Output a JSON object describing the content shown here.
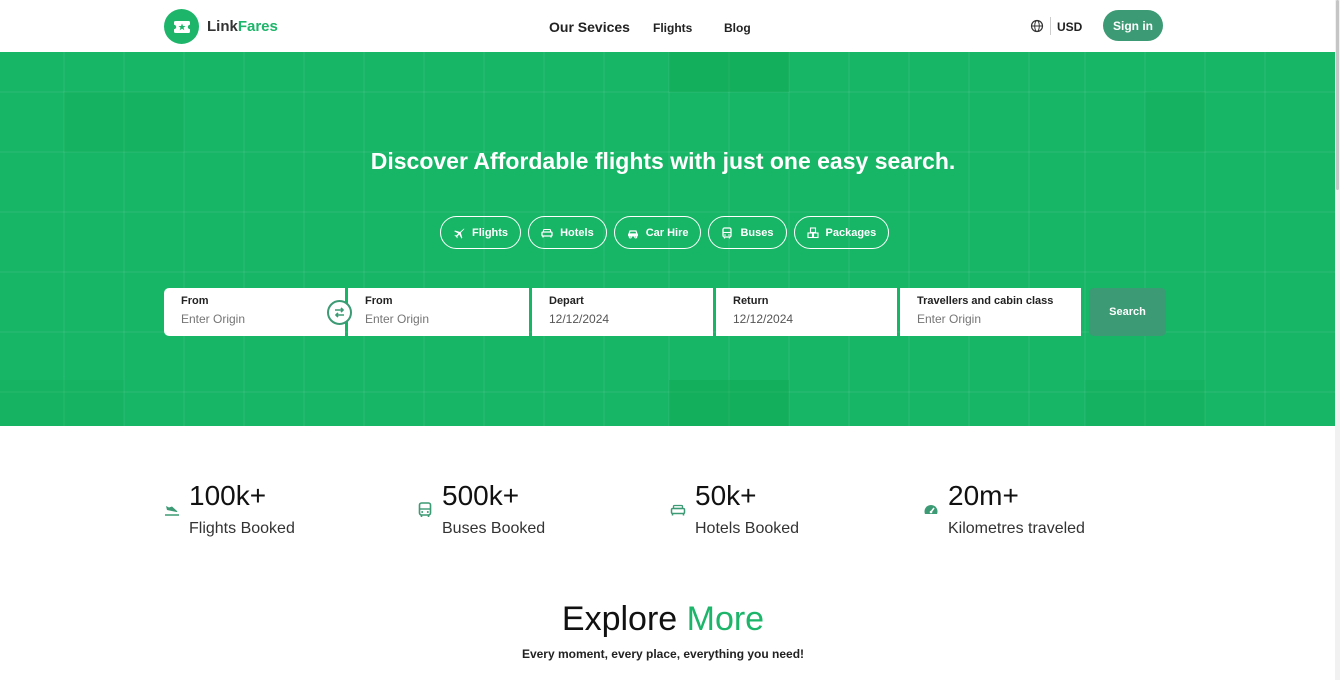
{
  "brand": {
    "name_part1": "Link",
    "name_part2": "Fares"
  },
  "nav": {
    "services": "Our Sevices",
    "flights": "Flights",
    "blog": "Blog"
  },
  "header": {
    "currency": "USD",
    "signin": "Sign in"
  },
  "hero": {
    "title": "Discover Affordable flights with just one easy search.",
    "tabs": [
      {
        "label": "Flights",
        "icon": "plane-icon"
      },
      {
        "label": "Hotels",
        "icon": "bed-icon"
      },
      {
        "label": "Car Hire",
        "icon": "car-icon"
      },
      {
        "label": "Buses",
        "icon": "bus-icon"
      },
      {
        "label": "Packages",
        "icon": "packages-icon"
      }
    ]
  },
  "search": {
    "fields": [
      {
        "label": "From",
        "placeholder": "Enter Origin",
        "value": ""
      },
      {
        "label": "From",
        "placeholder": "Enter Origin",
        "value": ""
      },
      {
        "label": "Depart",
        "placeholder": "",
        "value": "12/12/2024"
      },
      {
        "label": "Return",
        "placeholder": "",
        "value": "12/12/2024"
      },
      {
        "label": "Travellers and cabin class",
        "placeholder": "Enter Origin",
        "value": ""
      }
    ],
    "button": "Search"
  },
  "stats": [
    {
      "number": "100k+",
      "caption": "Flights Booked",
      "icon": "plane-landing-icon"
    },
    {
      "number": "500k+",
      "caption": "Buses Booked",
      "icon": "bus-icon"
    },
    {
      "number": "50k+",
      "caption": "Hotels Booked",
      "icon": "bed-icon"
    },
    {
      "number": "20m+",
      "caption": "Kilometres traveled",
      "icon": "speedometer-icon"
    }
  ],
  "explore": {
    "title_part1": "Explore",
    "title_part2": "More",
    "subtitle": "Every moment, every place, everything you need!"
  },
  "colors": {
    "brand_green": "#17b566",
    "accent_dark_green": "#3c9a74",
    "text": "#1a1a1a"
  }
}
